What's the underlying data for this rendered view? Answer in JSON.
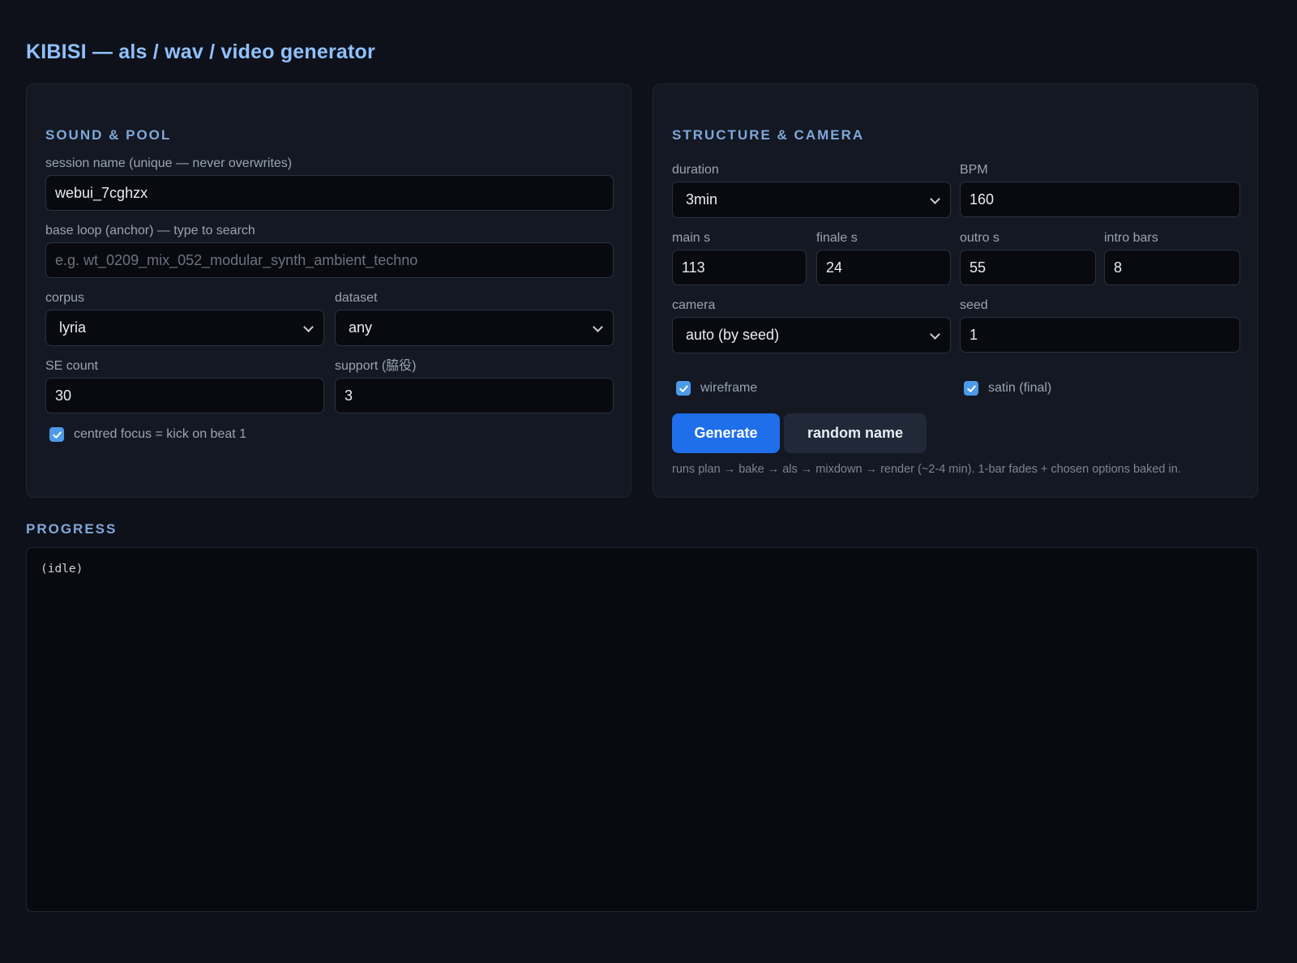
{
  "app": {
    "title": "KIBISI — als / wav / video generator"
  },
  "sound_pool": {
    "title": "SOUND & POOL",
    "session_name": {
      "label": "session name (unique — never overwrites)",
      "value": "webui_7cghzx"
    },
    "base_loop": {
      "label": "base loop (anchor) — type to search",
      "placeholder": "e.g. wt_0209_mix_052_modular_synth_ambient_techno",
      "value": ""
    },
    "corpus": {
      "label": "corpus",
      "value": "lyria"
    },
    "dataset": {
      "label": "dataset",
      "value": "any"
    },
    "se_count": {
      "label": "SE count",
      "value": "30"
    },
    "support": {
      "label": "support (脇役)",
      "value": "3"
    },
    "centred_focus": {
      "label": "centred focus = kick on beat 1",
      "checked": true
    }
  },
  "structure_camera": {
    "title": "STRUCTURE & CAMERA",
    "duration": {
      "label": "duration",
      "value": "3min"
    },
    "bpm": {
      "label": "BPM",
      "value": "160"
    },
    "main_s": {
      "label": "main s",
      "value": "113"
    },
    "finale_s": {
      "label": "finale s",
      "value": "24"
    },
    "outro_s": {
      "label": "outro s",
      "value": "55"
    },
    "intro_bars": {
      "label": "intro bars",
      "value": "8"
    },
    "camera": {
      "label": "camera",
      "value": "auto (by seed)"
    },
    "seed": {
      "label": "seed",
      "value": "1"
    },
    "wireframe": {
      "label": "wireframe",
      "checked": true
    },
    "satin": {
      "label": "satin (final)",
      "checked": true
    },
    "generate_label": "Generate",
    "random_name_label": "random name",
    "hint": "runs plan → bake → als → mixdown → render (~2-4 min). 1-bar fades + chosen options baked in."
  },
  "progress": {
    "title": "PROGRESS",
    "log": "(idle)"
  },
  "colors": {
    "background": "#0e1119",
    "panel": "#131823",
    "accent": "#1f6feb",
    "title": "#8fc1ff",
    "section_heading": "#7fa8d9",
    "checkbox": "#4c9be8"
  }
}
